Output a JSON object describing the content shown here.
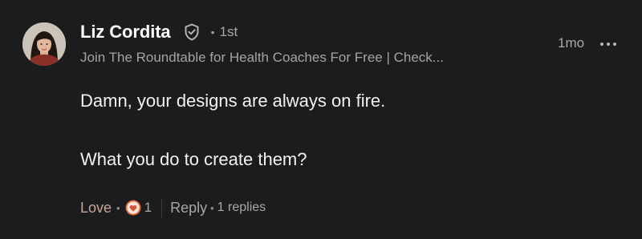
{
  "author": {
    "name": "Liz Cordita",
    "connection": "1st",
    "headline": "Join The Roundtable for Health Coaches For Free | Check..."
  },
  "timestamp": "1mo",
  "body": {
    "line1": "Damn, your designs are always on fire.",
    "line2": "What you do to create them?"
  },
  "actions": {
    "love_label": "Love",
    "reaction_count": "1",
    "reply_label": "Reply",
    "replies_text": "1 replies"
  },
  "icons": {
    "verified": "shield-check-icon",
    "more": "more-horizontal-icon",
    "reaction": "heart-reaction-icon"
  },
  "colors": {
    "background": "#1b1c1d",
    "love_accent": "#c9a79a",
    "reaction_orange": "#e06b3f"
  }
}
